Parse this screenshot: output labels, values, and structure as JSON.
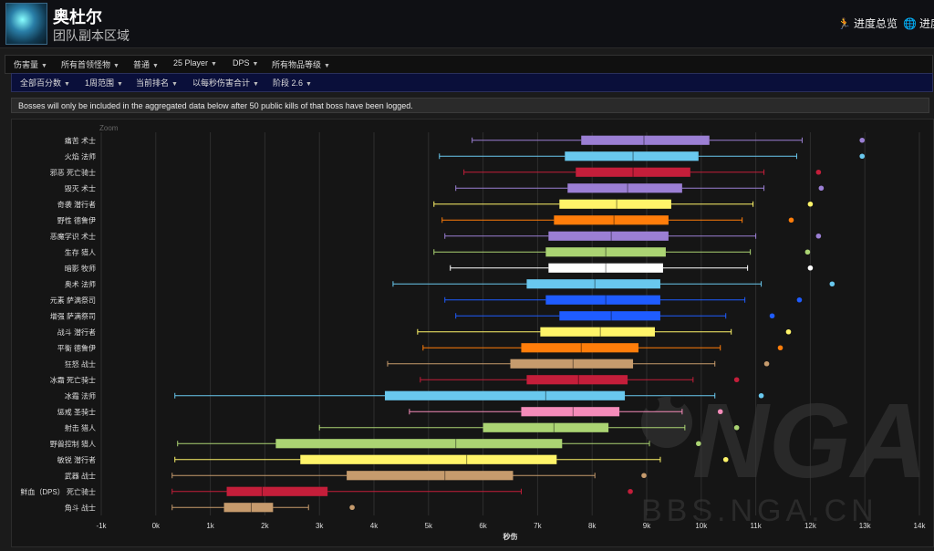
{
  "header": {
    "title": "奥杜尔",
    "subtitle": "团队副本区域",
    "links": [
      {
        "label": "进度总览",
        "icon": "runner-icon"
      },
      {
        "label": "进度",
        "icon": "globe-icon"
      }
    ]
  },
  "filters_row1": [
    "伤害量",
    "所有首领怪物",
    "普通",
    "25 Player",
    "DPS",
    "所有物品等级"
  ],
  "filters_row2": [
    "全部百分数",
    "1周范围",
    "当前排名",
    "以每秒伤害合计",
    "阶段 2.6"
  ],
  "notice": "Bosses will only be included in the aggregated data below after 50 public kills of that boss have been logged.",
  "zoom_label": "Zoom",
  "watermark": "BBS.NGA.CN",
  "chart_data": {
    "type": "boxplot",
    "orientation": "horizontal",
    "xlabel": "秒伤",
    "xlim": [
      -1000,
      14000
    ],
    "xticks": [
      "-1k",
      "0k",
      "1k",
      "2k",
      "3k",
      "4k",
      "5k",
      "6k",
      "7k",
      "8k",
      "9k",
      "10k",
      "11k",
      "12k",
      "13k",
      "14k"
    ],
    "grid": true,
    "series": [
      {
        "label": "痛苦 术士",
        "color": "#9b7fd4",
        "min": 5800,
        "q1": 7800,
        "median": 8950,
        "q3": 10150,
        "max": 11850,
        "outlier": 12950
      },
      {
        "label": "火焰 法师",
        "color": "#69c8ee",
        "min": 5200,
        "q1": 7500,
        "median": 8750,
        "q3": 9950,
        "max": 11750,
        "outlier": 12950
      },
      {
        "label": "邪恶 死亡骑士",
        "color": "#c41e3a",
        "min": 5650,
        "q1": 7700,
        "median": 8750,
        "q3": 9800,
        "max": 11150,
        "outlier": 12150
      },
      {
        "label": "毁灭 术士",
        "color": "#9b7fd4",
        "min": 5500,
        "q1": 7550,
        "median": 8650,
        "q3": 9650,
        "max": 11150,
        "outlier": 12200
      },
      {
        "label": "奇袭 潜行者",
        "color": "#fff469",
        "min": 5100,
        "q1": 7400,
        "median": 8450,
        "q3": 9450,
        "max": 10950,
        "outlier": 12000
      },
      {
        "label": "野性 德鲁伊",
        "color": "#ff7d0a",
        "min": 5250,
        "q1": 7300,
        "median": 8400,
        "q3": 9400,
        "max": 10750,
        "outlier": 11650
      },
      {
        "label": "恶魔学识 术士",
        "color": "#9b7fd4",
        "min": 5300,
        "q1": 7200,
        "median": 8350,
        "q3": 9400,
        "max": 11000,
        "outlier": 12150
      },
      {
        "label": "生存 猎人",
        "color": "#abd473",
        "min": 5100,
        "q1": 7150,
        "median": 8250,
        "q3": 9350,
        "max": 10900,
        "outlier": 11950
      },
      {
        "label": "暗影 牧师",
        "color": "#ffffff",
        "min": 5400,
        "q1": 7200,
        "median": 8250,
        "q3": 9300,
        "max": 10850,
        "outlier": 12000
      },
      {
        "label": "奥术 法师",
        "color": "#69c8ee",
        "min": 4350,
        "q1": 6800,
        "median": 8050,
        "q3": 9250,
        "max": 11100,
        "outlier": 12400
      },
      {
        "label": "元素 萨满祭司",
        "color": "#1f5cff",
        "min": 5300,
        "q1": 7150,
        "median": 8250,
        "q3": 9250,
        "max": 10800,
        "outlier": 11800
      },
      {
        "label": "增强 萨满祭司",
        "color": "#1f5cff",
        "min": 5500,
        "q1": 7400,
        "median": 8350,
        "q3": 9250,
        "max": 10450,
        "outlier": 11300
      },
      {
        "label": "战斗 潜行者",
        "color": "#fff469",
        "min": 4800,
        "q1": 7050,
        "median": 8150,
        "q3": 9150,
        "max": 10550,
        "outlier": 11600
      },
      {
        "label": "平衡 德鲁伊",
        "color": "#ff7d0a",
        "min": 4900,
        "q1": 6700,
        "median": 7800,
        "q3": 8850,
        "max": 10350,
        "outlier": 11450
      },
      {
        "label": "狂怒 战士",
        "color": "#c69b6d",
        "min": 4250,
        "q1": 6500,
        "median": 7650,
        "q3": 8750,
        "max": 10250,
        "outlier": 11200
      },
      {
        "label": "冰霜 死亡骑士",
        "color": "#c41e3a",
        "min": 4850,
        "q1": 6800,
        "median": 7750,
        "q3": 8650,
        "max": 9850,
        "outlier": 10650
      },
      {
        "label": "冰霜 法师",
        "color": "#69c8ee",
        "min": 350,
        "q1": 4200,
        "median": 7150,
        "q3": 8600,
        "max": 10250,
        "outlier": 11100
      },
      {
        "label": "惩戒 圣骑士",
        "color": "#f58cba",
        "min": 4650,
        "q1": 6700,
        "median": 7650,
        "q3": 8500,
        "max": 9650,
        "outlier": 10350
      },
      {
        "label": "射击 猎人",
        "color": "#abd473",
        "min": 3000,
        "q1": 6000,
        "median": 7300,
        "q3": 8300,
        "max": 9700,
        "outlier": 10650
      },
      {
        "label": "野兽控制 猎人",
        "color": "#abd473",
        "min": 400,
        "q1": 2200,
        "median": 5500,
        "q3": 7450,
        "max": 9050,
        "outlier": 9950
      },
      {
        "label": "敏锐 潜行者",
        "color": "#fff469",
        "min": 350,
        "q1": 2650,
        "median": 5700,
        "q3": 7350,
        "max": 9250,
        "outlier": 10450
      },
      {
        "label": "武器 战士",
        "color": "#c69b6d",
        "min": 300,
        "q1": 3500,
        "median": 5300,
        "q3": 6550,
        "max": 8050,
        "outlier": 8950
      },
      {
        "label": "鲜血（DPS） 死亡骑士",
        "color": "#c41e3a",
        "min": 300,
        "q1": 1300,
        "median": 1950,
        "q3": 3150,
        "max": 6700,
        "outlier": 8700
      },
      {
        "label": "角斗 战士",
        "color": "#c69b6d",
        "min": 300,
        "q1": 1250,
        "median": 1750,
        "q3": 2150,
        "max": 2800,
        "outlier": 3600
      }
    ]
  }
}
